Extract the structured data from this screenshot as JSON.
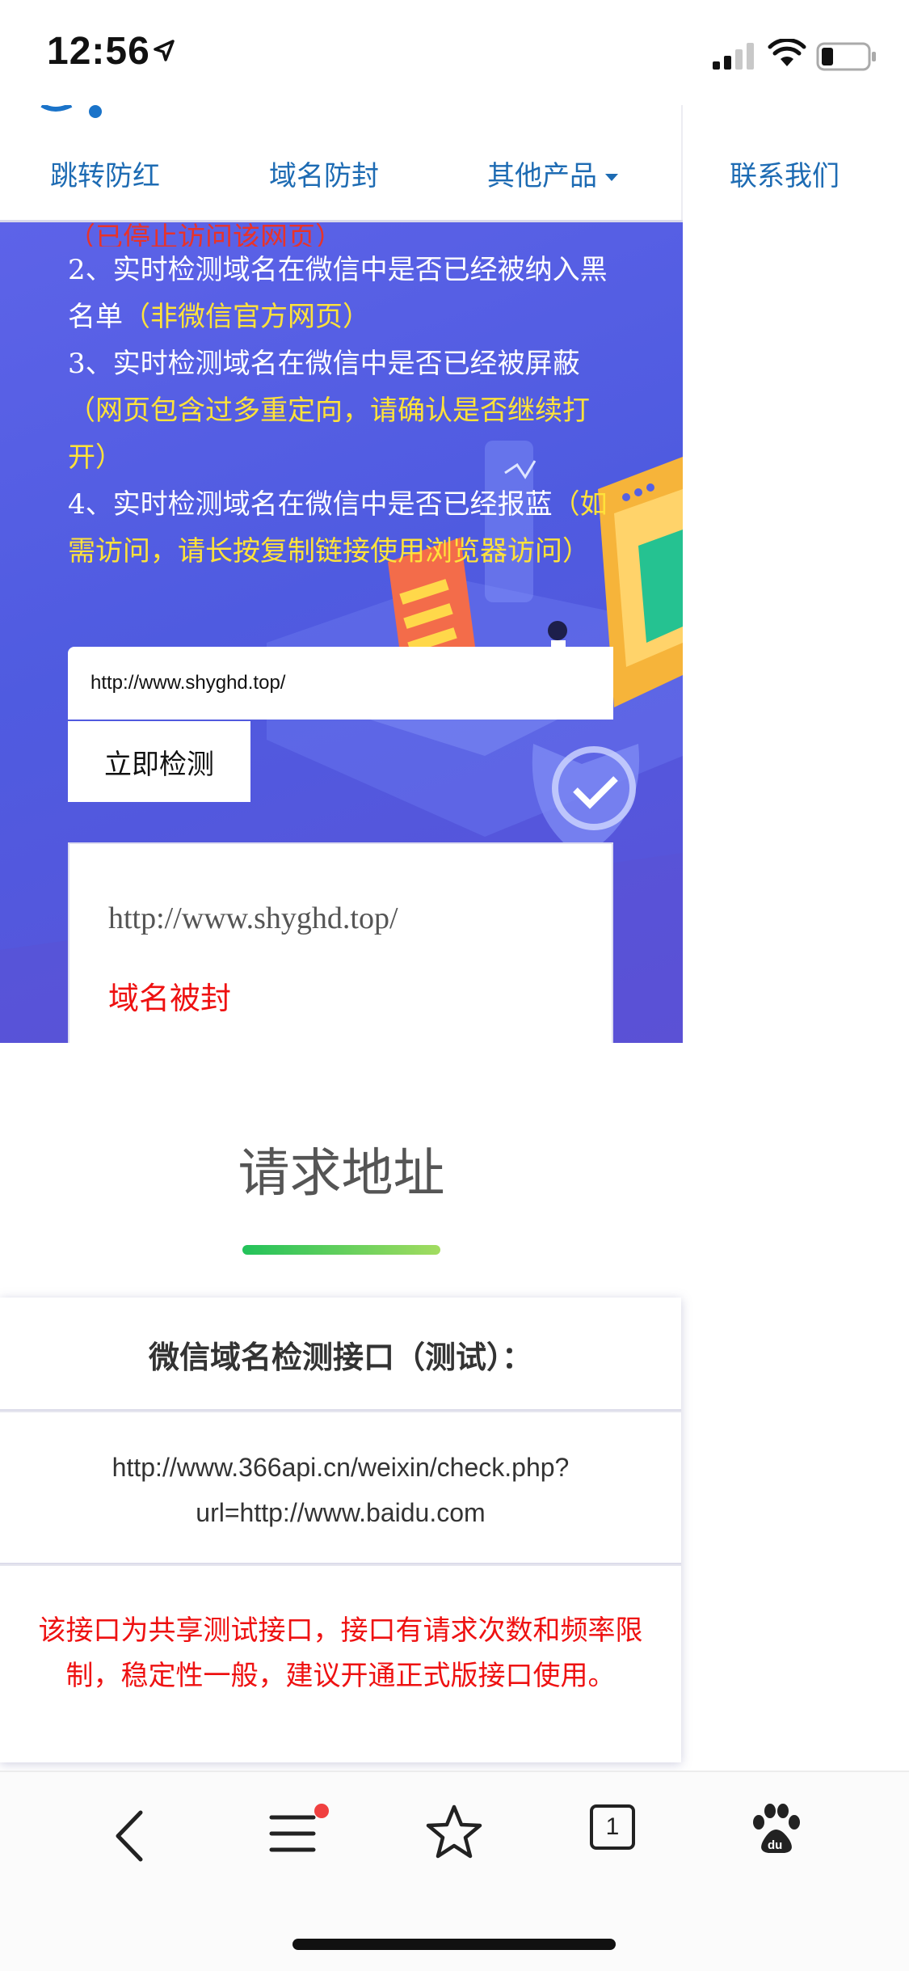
{
  "status_bar": {
    "time": "12:56"
  },
  "nav": {
    "items": [
      {
        "label": "跳转防红"
      },
      {
        "label": "域名防封"
      },
      {
        "label": "其他产品"
      },
      {
        "label": "联系我们"
      }
    ]
  },
  "hero": {
    "line_cut": "（已停止访问该网页）",
    "item2": "2、实时检测域名在微信中是否已经被纳入黑名单",
    "item2_note": "（非微信官方网页）",
    "item3": "3、实时检测域名在微信中是否已经被屏蔽",
    "item3_note": "（网页包含过多重定向，请确认是否继续打开）",
    "item4": "4、实时检测域名在微信中是否已经报蓝",
    "item4_note": "（如需访问，请长按复制链接使用浏览器访问）",
    "input_value": "http://www.shyghd.top/",
    "check_button": "立即检测",
    "result_url": "http://www.shyghd.top/",
    "result_status": "域名被封"
  },
  "section": {
    "title": "请求地址"
  },
  "api_card": {
    "title": "微信域名检测接口（测试）：",
    "url_line1": "http://www.366api.cn/weixin/check.php?",
    "url_line2": "url=http://www.baidu.com",
    "note": "该接口为共享测试接口，接口有请求次数和频率限制，稳定性一般，建议开通正式版接口使用。"
  },
  "browser_bar": {
    "tab_count": "1",
    "icons": [
      "back-icon",
      "menu-icon",
      "star-icon",
      "tabs-icon",
      "baidu-icon"
    ]
  },
  "colors": {
    "accent": "#1d6bb3",
    "hero_bg": "#5560e2",
    "alert": "#ee1111",
    "note_yellow": "#ffe23a"
  }
}
